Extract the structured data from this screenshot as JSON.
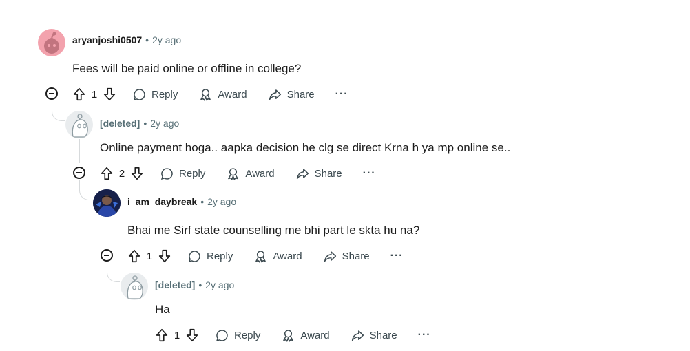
{
  "comments": [
    {
      "username": "aryanjoshi0507",
      "separator": "•",
      "time": "2y ago",
      "body": "Fees will be paid online or offline in college?",
      "votes": "1",
      "reply": "Reply",
      "award": "Award",
      "share": "Share",
      "more": "···",
      "avatar": "snoo-pink-icon"
    },
    {
      "username": "[deleted]",
      "separator": "•",
      "time": "2y ago",
      "body": "Online payment hoga.. aapka decision he clg se direct Krna h ya mp online se..",
      "votes": "2",
      "reply": "Reply",
      "award": "Award",
      "share": "Share",
      "more": "···",
      "avatar": "snoo-ghost-icon"
    },
    {
      "username": "i_am_daybreak",
      "separator": "•",
      "time": "2y ago",
      "body": "Bhai me Sirf state counselling me bhi part le skta hu na?",
      "votes": "1",
      "reply": "Reply",
      "award": "Award",
      "share": "Share",
      "more": "···",
      "avatar": "user-photo-icon"
    },
    {
      "username": "[deleted]",
      "separator": "•",
      "time": "2y ago",
      "body": "Ha",
      "votes": "1",
      "reply": "Reply",
      "award": "Award",
      "share": "Share",
      "more": "···",
      "avatar": "snoo-ghost-icon"
    }
  ]
}
